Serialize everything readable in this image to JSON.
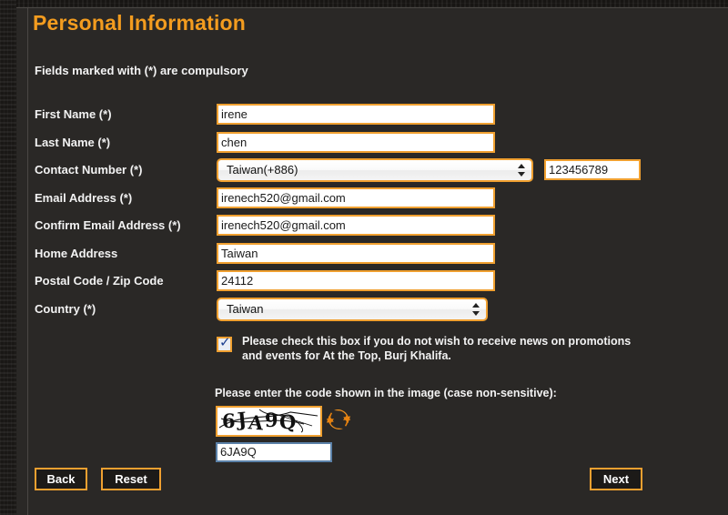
{
  "page": {
    "title": "Personal Information",
    "note": "Fields marked with (*) are compulsory"
  },
  "form": {
    "rows": [
      {
        "label": "First Name (*)",
        "type": "text",
        "value": "irene"
      },
      {
        "label": "Last Name (*)",
        "type": "text",
        "value": "chen"
      },
      {
        "label": "Contact Number (*)",
        "type": "select_plus_text",
        "value": "Taiwan(+886)",
        "phone_value": "123456789"
      },
      {
        "label": "Email Address (*)",
        "type": "text",
        "value": "irenech520@gmail.com"
      },
      {
        "label": "Confirm Email Address (*)",
        "type": "text",
        "value": "irenech520@gmail.com"
      },
      {
        "label": "Home Address",
        "type": "text",
        "value": "Taiwan"
      },
      {
        "label": "Postal Code / Zip Code",
        "type": "text",
        "value": "24112"
      },
      {
        "label": "Country (*)",
        "type": "select",
        "value": "Taiwan"
      }
    ]
  },
  "newsletter": {
    "checked": true,
    "text": "Please check this box if you do not wish to receive news on promotions and events for At the Top, Burj Khalifa."
  },
  "captcha": {
    "prompt": "Please enter the code shown in the image (case non-sensitive):",
    "image_code": "6JA9Q",
    "input_value": "6JA9Q",
    "refresh_icon": "refresh-icon"
  },
  "buttons": {
    "back": "Back",
    "reset": "Reset",
    "next": "Next"
  },
  "colors": {
    "background": "#2a2826",
    "accent_orange": "#f0a030",
    "title_orange": "#f39c1f",
    "text_white": "#f2f2f2",
    "focus_blue": "#5b81a8"
  }
}
